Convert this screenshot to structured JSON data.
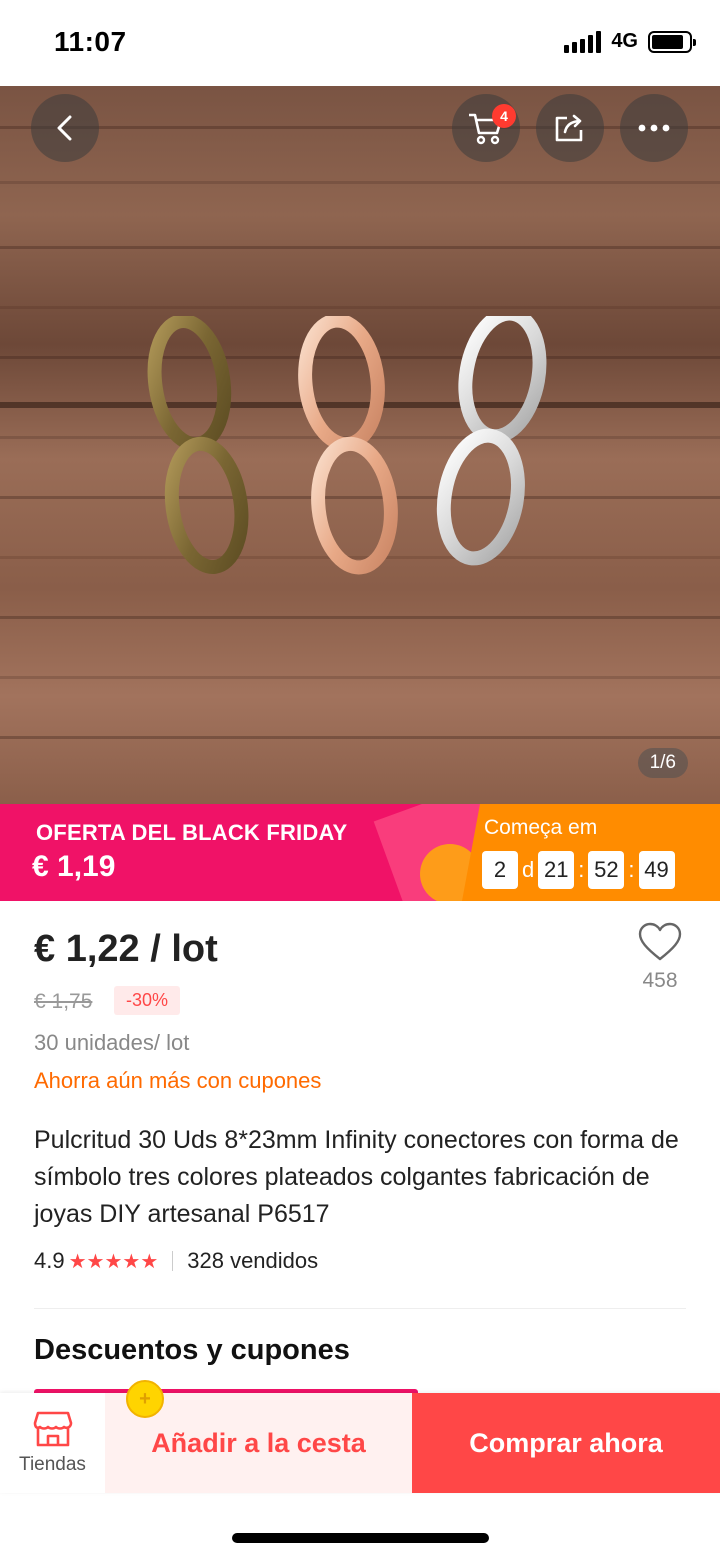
{
  "status_bar": {
    "time": "11:07",
    "network": "4G",
    "battery_level": 0.85
  },
  "header": {
    "back_icon": "chevron-left-icon",
    "cart_icon": "cart-icon",
    "cart_count": "4",
    "share_icon": "share-icon",
    "more_icon": "more-icon"
  },
  "gallery": {
    "counter": "1/6"
  },
  "promo": {
    "title": "OFERTA DEL BLACK FRIDAY",
    "price": "€ 1,19",
    "starts_label": "Começa em",
    "countdown": {
      "days": "2",
      "days_unit": "d",
      "hours": "21",
      "minutes": "52",
      "seconds": "49"
    },
    "colors": {
      "pink": "#f01267",
      "orange": "#ff8c00"
    }
  },
  "product": {
    "price": "€ 1,22 / lot",
    "original_price": "€ 1,75",
    "discount": "-30%",
    "units": "30 unidades/ lot",
    "coupon_link": "Ahorra aún más con cupones",
    "title": "Pulcritud 30 Uds 8*23mm Infinity conectores con forma de símbolo tres colores plateados colgantes fabricación de joyas DIY artesanal P6517",
    "rating": "4.9",
    "stars": 5,
    "sold": "328 vendidos",
    "wishlist_count": "458"
  },
  "sections": {
    "discounts_title": "Descuentos y cupones"
  },
  "bottom_bar": {
    "store_label": "Tiendas",
    "add_to_cart": "Añadir a la cesta",
    "buy_now": "Comprar ahora",
    "accent": "#ff4747"
  }
}
